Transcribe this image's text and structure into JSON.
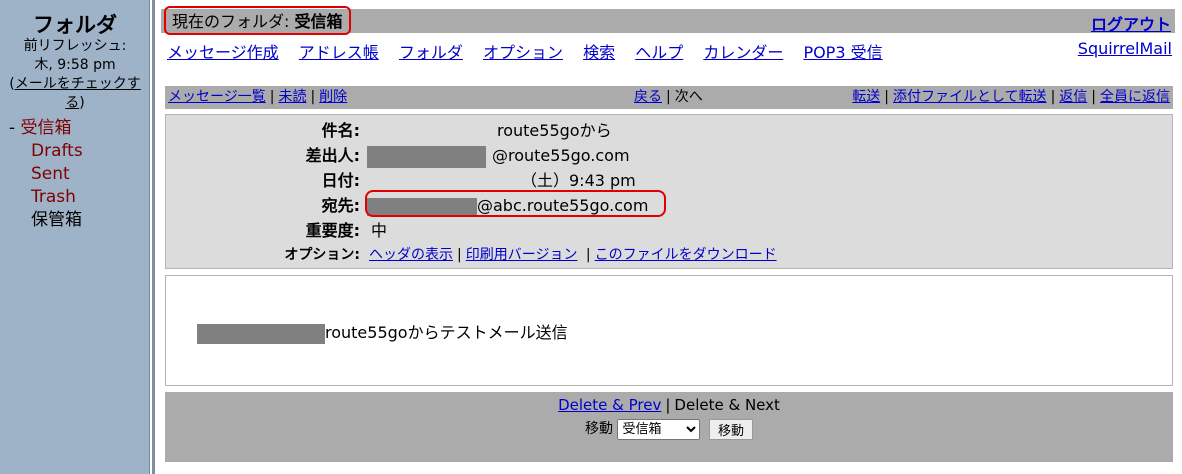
{
  "sidebar": {
    "title": "フォルダ",
    "refresh_label": "前リフレッシュ:",
    "refresh_time": "木, 9:58 pm",
    "check_mail_open": "(",
    "check_mail": "メールをチェックする",
    "check_mail_close": ")",
    "folders": [
      {
        "prefix": "- ",
        "label": "受信箱"
      },
      {
        "label": "Drafts"
      },
      {
        "label": "Sent"
      },
      {
        "label": "Trash"
      },
      {
        "label": "保管箱"
      }
    ]
  },
  "header": {
    "folder_prefix": "現在のフォルダ: ",
    "folder_name": "受信箱",
    "logout": "ログアウト",
    "brand": "SquirrelMail",
    "menu": [
      "メッセージ作成",
      "アドレス帳",
      "フォルダ",
      "オプション",
      "検索",
      "ヘルプ",
      "カレンダー",
      "POP3 受信"
    ]
  },
  "msgnav": {
    "list": "メッセージ一覧",
    "unread": "未読",
    "delete": "削除",
    "back": "戻る",
    "next": "次へ",
    "forward": "転送",
    "forward_attach": "添付ファイルとして転送",
    "reply": "返信",
    "reply_all": "全員に返信"
  },
  "headers": {
    "subject_label": "件名:",
    "subject_value": "route55goから",
    "from_label": "差出人:",
    "from_value": "@route55go.com",
    "date_label": "日付:",
    "date_value": "（土）9:43 pm",
    "to_label": "宛先:",
    "to_value": "@abc.route55go.com",
    "priority_label": "重要度:",
    "priority_value": "中",
    "options_label": "オプション:",
    "opt_headers": "ヘッダの表示",
    "opt_print": "印刷用バージョン",
    "opt_download": "このファイルをダウンロード"
  },
  "body": {
    "text": "route55goからテストメール送信"
  },
  "footer": {
    "delete_prev": "Delete & Prev",
    "delete_next": "Delete & Next",
    "move_label": "移動",
    "move_selected": "受信箱",
    "move_button": "移動"
  },
  "colors": {
    "sidebar_bg": "#9fb3c8",
    "bar_bg": "#ababab",
    "header_bg": "#dcdcdc",
    "highlight": "#e00000",
    "folder_text": "#800000",
    "link": "#0000cc"
  }
}
